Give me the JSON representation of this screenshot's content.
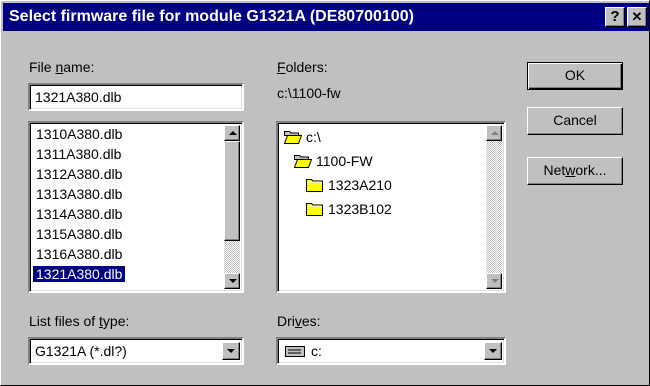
{
  "window": {
    "title": "Select firmware file for module G1321A (DE80700100)",
    "help_label": "?",
    "close_label": "✕"
  },
  "file_name": {
    "label_pre": "File ",
    "label_ul": "n",
    "label_post": "ame:",
    "value": "1321A380.dlb",
    "list": [
      "1310A380.dlb",
      "1311A380.dlb",
      "1312A380.dlb",
      "1313A380.dlb",
      "1314A380.dlb",
      "1315A380.dlb",
      "1316A380.dlb",
      "1321A380.dlb"
    ],
    "selected": "1321A380.dlb"
  },
  "folders": {
    "label_ul": "F",
    "label_post": "olders:",
    "current_path": "c:\\1100-fw",
    "tree": [
      {
        "name": "c:\\",
        "icon": "open-folder-icon"
      },
      {
        "name": "1100-FW",
        "icon": "open-folder-icon"
      },
      {
        "name": "1323A210",
        "icon": "folder-icon"
      },
      {
        "name": "1323B102",
        "icon": "folder-icon"
      }
    ]
  },
  "file_types": {
    "label_pre": "List files of ",
    "label_ul": "t",
    "label_post": "ype:",
    "value": "G1321A (*.dl?)"
  },
  "drives": {
    "label_pre": "Dri",
    "label_ul": "v",
    "label_post": "es:",
    "value": "c:",
    "icon": "drive-icon"
  },
  "buttons": {
    "ok": "OK",
    "cancel": "Cancel",
    "network_pre": "Net",
    "network_ul": "w",
    "network_post": "ork..."
  },
  "colors": {
    "title_bar": "#000080",
    "face": "#c0c0c0",
    "selection": "#000080",
    "folder": "#ffff00"
  }
}
